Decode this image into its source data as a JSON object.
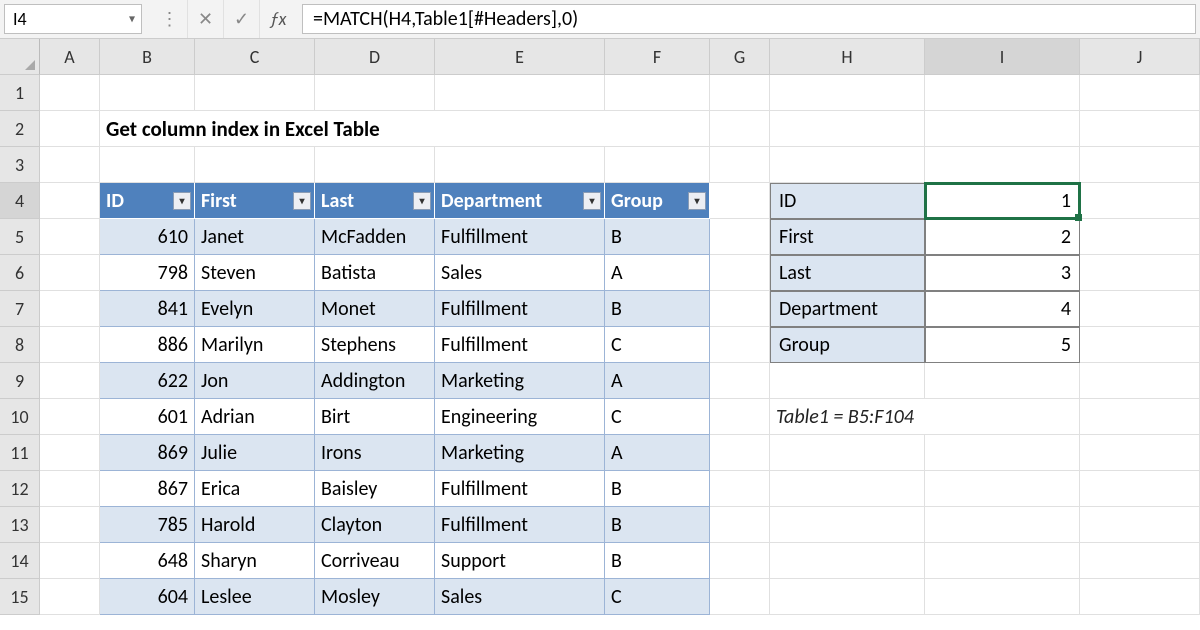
{
  "formula_bar": {
    "name_box": "I4",
    "formula": "=MATCH(H4,Table1[#Headers],0)"
  },
  "columns": [
    "A",
    "B",
    "C",
    "D",
    "E",
    "F",
    "G",
    "H",
    "I",
    "J"
  ],
  "row_numbers": [
    "1",
    "2",
    "3",
    "4",
    "5",
    "6",
    "7",
    "8",
    "9",
    "10",
    "11",
    "12",
    "13",
    "14",
    "15"
  ],
  "title": "Get column index in Excel Table",
  "table": {
    "headers": [
      "ID",
      "First",
      "Last",
      "Department",
      "Group"
    ],
    "rows": [
      {
        "id": "610",
        "first": "Janet",
        "last": "McFadden",
        "dept": "Fulfillment",
        "group": "B"
      },
      {
        "id": "798",
        "first": "Steven",
        "last": "Batista",
        "dept": "Sales",
        "group": "A"
      },
      {
        "id": "841",
        "first": "Evelyn",
        "last": "Monet",
        "dept": "Fulfillment",
        "group": "B"
      },
      {
        "id": "886",
        "first": "Marilyn",
        "last": "Stephens",
        "dept": "Fulfillment",
        "group": "C"
      },
      {
        "id": "622",
        "first": "Jon",
        "last": "Addington",
        "dept": "Marketing",
        "group": "A"
      },
      {
        "id": "601",
        "first": "Adrian",
        "last": "Birt",
        "dept": "Engineering",
        "group": "C"
      },
      {
        "id": "869",
        "first": "Julie",
        "last": "Irons",
        "dept": "Marketing",
        "group": "A"
      },
      {
        "id": "867",
        "first": "Erica",
        "last": "Baisley",
        "dept": "Fulfillment",
        "group": "B"
      },
      {
        "id": "785",
        "first": "Harold",
        "last": "Clayton",
        "dept": "Fulfillment",
        "group": "B"
      },
      {
        "id": "648",
        "first": "Sharyn",
        "last": "Corriveau",
        "dept": "Support",
        "group": "B"
      },
      {
        "id": "604",
        "first": "Leslee",
        "last": "Mosley",
        "dept": "Sales",
        "group": "C"
      }
    ]
  },
  "lookup": {
    "rows": [
      {
        "label": "ID",
        "value": "1"
      },
      {
        "label": "First",
        "value": "2"
      },
      {
        "label": "Last",
        "value": "3"
      },
      {
        "label": "Department",
        "value": "4"
      },
      {
        "label": "Group",
        "value": "5"
      }
    ]
  },
  "note": "Table1 = B5:F104",
  "icons": {
    "dropdown": "▾",
    "cancel": "✕",
    "enter": "✓",
    "divider": "⋮"
  }
}
